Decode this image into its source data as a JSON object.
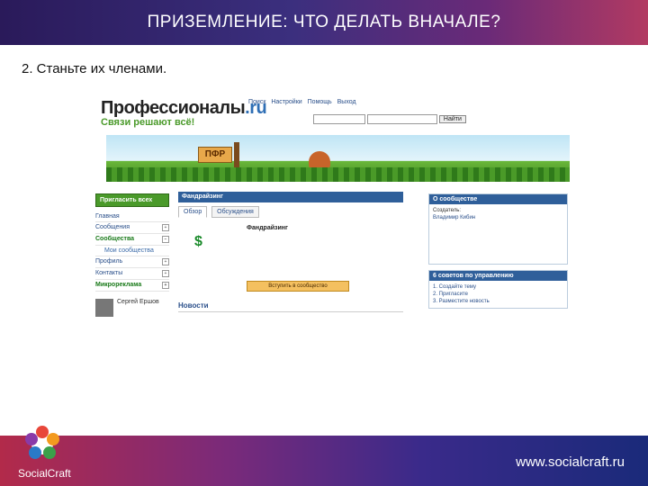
{
  "slide": {
    "title": "ПРИЗЕМЛЕНИЕ: ЧТО ДЕЛАТЬ ВНАЧАЛЕ?",
    "subtitle": "2. Станьте их членами.",
    "brand": "SocialCraft",
    "website": "www.socialcraft.ru",
    "colors": {
      "accent_red": "#b22a4a",
      "accent_blue": "#1a2a7a"
    }
  },
  "site": {
    "logo": "Профессионалы",
    "logo_suffix": ".ru",
    "slogan": "Связи решают всё!",
    "topnav": [
      "Поиск",
      "Настройки",
      "Помощь",
      "Выход"
    ],
    "search_button": "Найти",
    "banner_sign": "ПФР",
    "invite_button": "Пригласить всех",
    "menu": [
      {
        "label": "Главная",
        "icon": "home-icon"
      },
      {
        "label": "Сообщения",
        "icon": "mail-icon"
      },
      {
        "label": "Сообщества",
        "icon": "group-icon"
      }
    ],
    "sub_menu": [
      "Мои сообщества"
    ],
    "menu2": [
      {
        "label": "Профиль",
        "icon": "profile-icon"
      },
      {
        "label": "Контакты",
        "icon": "contacts-icon"
      },
      {
        "label": "Микрореклама",
        "icon": "ad-icon"
      }
    ],
    "person": {
      "name": "Сергей Ершов"
    },
    "community": {
      "header": "Фандрайзинг",
      "tabs": [
        "Обзор",
        "Обсуждения"
      ],
      "title": "Фандрайзинг",
      "join_button": "Вступить в сообщество"
    },
    "news": {
      "title": "Новости"
    },
    "about": {
      "header": "О сообществе",
      "creator_label": "Создатель:",
      "creator_name": "Владимир Кибин"
    },
    "tips": {
      "header": "6 советов по управлению",
      "items": [
        "1. Создайте тему",
        "2. Пригласите",
        "3. Разместите новость"
      ]
    }
  }
}
